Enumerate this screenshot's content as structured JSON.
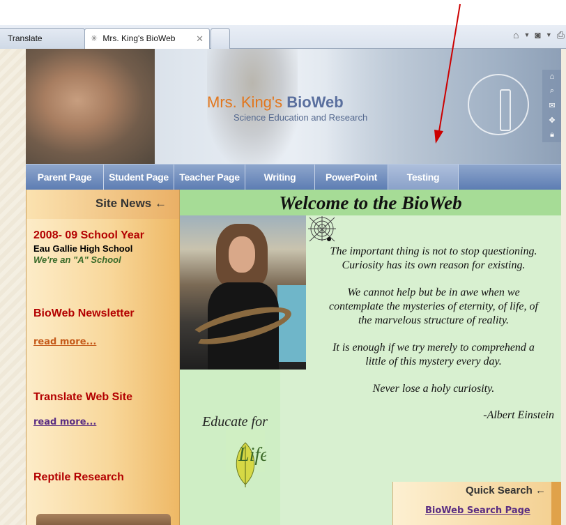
{
  "browser": {
    "tabs": [
      {
        "label": "Translate"
      },
      {
        "label": "Mrs. King's BioWeb"
      }
    ],
    "toolbar_icons": [
      "home-icon",
      "rss-feed-icon",
      "print-icon"
    ]
  },
  "banner": {
    "brand_first": "Mrs. King's ",
    "brand_second": "BioWeb",
    "subtitle": "Science Education and Research",
    "side_icons": [
      "home-icon",
      "search-icon",
      "mail-icon",
      "move-icon",
      "lock-icon"
    ]
  },
  "nav": {
    "items": [
      {
        "label": "Parent Page"
      },
      {
        "label": "Student Page"
      },
      {
        "label": "Teacher Page"
      },
      {
        "label": "Writing"
      },
      {
        "label": "PowerPoint"
      },
      {
        "label": "Testing"
      }
    ]
  },
  "sidebar": {
    "heading": "Site News ←",
    "school_year": "2008- 09 School Year",
    "school_name": "Eau Gallie High School",
    "motto": "We're an \"A\" School",
    "newsletter_title": "BioWeb Newsletter",
    "newsletter_link": "read more...",
    "translate_title": "Translate Web Site",
    "translate_link": "read more...",
    "reptile_title": "Reptile Research"
  },
  "main": {
    "welcome": "Welcome to the BioWeb",
    "quote_lines": [
      "The important thing is not to stop questioning.",
      "Curiosity has its own reason for existing.",
      "We cannot help but be in awe when we",
      "contemplate the mysteries of eternity, of life, of",
      "the marvelous structure of reality.",
      "It is enough if we try merely to comprehend a",
      "little of this mystery every day.",
      "Never lose a holy curiosity."
    ],
    "author": "-Albert Einstein",
    "educate": "Educate for",
    "life_logo_text": "Life"
  },
  "quick_search": {
    "heading": "Quick Search ←",
    "link": "BioWeb Search Page"
  },
  "colors": {
    "nav_blue": "#5d7db3",
    "welcome_green": "#a6dc96",
    "sidebar_orange": "#eeb865",
    "heading_red": "#b30000",
    "link_purple": "#5a2d82",
    "annotation_red": "#cc0000"
  }
}
